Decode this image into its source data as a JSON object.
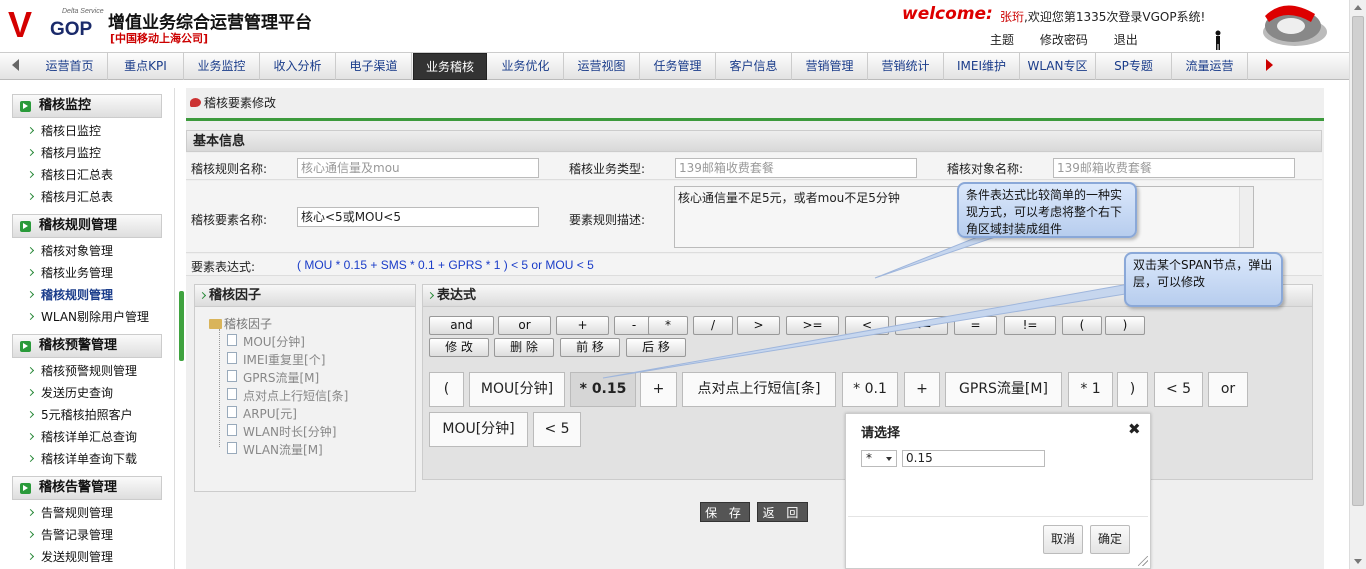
{
  "header": {
    "logo_ds": "Delta Service",
    "logo_v": "V",
    "logo_gop": "GOP",
    "platform_title": "增值业务综合运营管理平台",
    "company": "[中国移动上海公司]",
    "welcome_word": "welcome:",
    "welcome_user": "张珩",
    "welcome_text": ",欢迎您第1335次登录VGOP系统!",
    "links": [
      "主题",
      "修改密码",
      "退出"
    ]
  },
  "nav": {
    "items": [
      "运营首页",
      "重点KPI",
      "业务监控",
      "收入分析",
      "电子渠道",
      "业务稽核",
      "业务优化",
      "运营视图",
      "任务管理",
      "客户信息",
      "营销管理",
      "营销统计",
      "IMEI维护",
      "WLAN专区",
      "SP专题",
      "流量运营"
    ],
    "active_index": 5
  },
  "sidebar": {
    "groups": [
      {
        "title": "稽核监控",
        "items": [
          "稽核日监控",
          "稽核月监控",
          "稽核日汇总表",
          "稽核月汇总表"
        ]
      },
      {
        "title": "稽核规则管理",
        "items": [
          "稽核对象管理",
          "稽核业务管理",
          "稽核规则管理",
          "WLAN剔除用户管理"
        ]
      },
      {
        "title": "稽核预警管理",
        "items": [
          "稽核预警规则管理",
          "发送历史查询",
          "5元稽核拍照客户",
          "稽核详单汇总查询",
          "稽核详单查询下载"
        ]
      },
      {
        "title": "稽核告警管理",
        "items": [
          "告警规则管理",
          "告警记录管理",
          "发送规则管理"
        ]
      }
    ],
    "current_item": "稽核规则管理"
  },
  "content": {
    "breadcrumb": "稽核要素修改",
    "basic_title": "基本信息",
    "rule_name_label": "稽核规则名称:",
    "rule_name_value": "核心通信量及mou",
    "biz_type_label": "稽核业务类型:",
    "biz_type_value": "139邮箱收费套餐",
    "object_label": "稽核对象名称:",
    "object_value": "139邮箱收费套餐",
    "element_label": "稽核要素名称:",
    "element_value": "核心<5或MOU<5",
    "desc_label": "要素规则描述:",
    "desc_value": "核心通信量不足5元，或者mou不足5分钟",
    "expr_label": "要素表达式:",
    "expr_value": "( MOU * 0.15 + SMS * 0.1 + GPRS * 1 ) < 5 or MOU < 5"
  },
  "factor_panel": {
    "title": "稽核因子",
    "root": "稽核因子",
    "items": [
      "MOU[分钟]",
      "IMEI重复里[个]",
      "GPRS流量[M]",
      "点对点上行短信[条]",
      "ARPU[元]",
      "WLAN时长[分钟]",
      "WLAN流量[M]"
    ]
  },
  "expr_panel": {
    "title": "表达式",
    "operators": [
      "and",
      "or",
      "+",
      "-",
      "*",
      "/",
      ">",
      ">=",
      "<",
      "<=",
      "=",
      "!=",
      "(",
      ")"
    ],
    "edit_buttons": [
      "修 改",
      "删 除",
      "前 移",
      "后 移"
    ],
    "tokens_row1": [
      "(",
      "MOU[分钟]",
      "* 0.15",
      "+",
      "点对点上行短信[条]",
      "* 0.1",
      "+",
      "GPRS流量[M]",
      "* 1",
      ")",
      "< 5",
      "or"
    ],
    "tokens_row2": [
      "MOU[分钟]",
      "< 5"
    ]
  },
  "actions": {
    "save": "保 存",
    "back": "返 回"
  },
  "tooltips": {
    "tip1": "条件表达式比较简单的一种实现方式，可以考虑将整个右下角区域封装成组件",
    "tip2": "双击某个SPAN节点，弹出层，可以修改"
  },
  "dialog": {
    "title": "请选择",
    "close": "✖",
    "select_value": "*",
    "input_value": "0.15",
    "cancel": "取消",
    "confirm": "确定"
  }
}
